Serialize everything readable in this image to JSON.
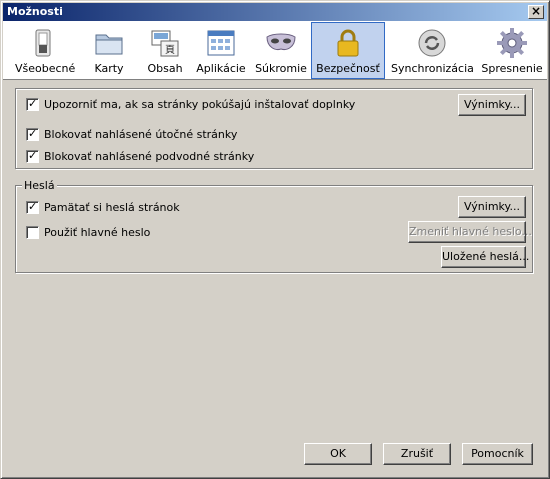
{
  "window": {
    "title": "Možnosti"
  },
  "toolbar": {
    "panes": [
      {
        "label": "Všeobecné",
        "icon": "switch-icon"
      },
      {
        "label": "Karty",
        "icon": "tabs-folder-icon"
      },
      {
        "label": "Obsah",
        "icon": "content-icon"
      },
      {
        "label": "Aplikácie",
        "icon": "applications-icon"
      },
      {
        "label": "Súkromie",
        "icon": "privacy-mask-icon"
      },
      {
        "label": "Bezpečnosť",
        "icon": "padlock-icon",
        "selected": true
      },
      {
        "label": "Synchronizácia",
        "icon": "sync-icon"
      },
      {
        "label": "Spresnenie",
        "icon": "gear-icon"
      }
    ]
  },
  "security": {
    "warn_addons": {
      "label": "Upozorniť ma, ak sa stránky pokúšajú inštalovať doplnky",
      "checked": true
    },
    "warn_addons_exceptions": "Výnimky...",
    "block_attack": {
      "label": "Blokovať nahlásené útočné stránky",
      "checked": true
    },
    "block_forgery": {
      "label": "Blokovať nahlásené podvodné stránky",
      "checked": true
    }
  },
  "passwords": {
    "group_label": "Heslá",
    "remember": {
      "label": "Pamätať si heslá stránok",
      "checked": true
    },
    "remember_exceptions": "Výnimky...",
    "master": {
      "label": "Použiť hlavné heslo",
      "checked": false
    },
    "change_master": "Zmeniť hlavné heslo...",
    "saved": "Uložené heslá..."
  },
  "footer": {
    "ok": "OK",
    "cancel": "Zrušiť",
    "help": "Pomocník"
  },
  "colors": {
    "titlebar_start": "#0a246a",
    "titlebar_end": "#a6caf0",
    "selected_pane": "#c1d2ee",
    "window_bg": "#d4d0c8"
  }
}
